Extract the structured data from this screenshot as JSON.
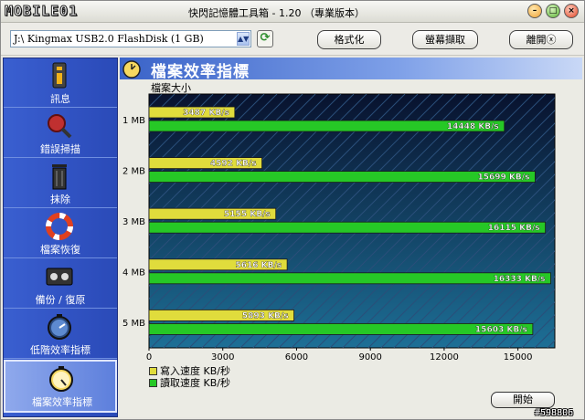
{
  "window": {
    "logo_text": "MOBILE01",
    "title": "快閃記憶體工具箱 - 1.20 （專業版本）"
  },
  "toolbar": {
    "drive": "J:\\ Kingmax USB2.0 FlashDisk (1 GB)",
    "format_label": "格式化",
    "capture_label": "螢幕擷取",
    "leave_label": "離開ⓧ"
  },
  "sidebar": {
    "items": [
      {
        "label": "訊息",
        "icon": "info-icon"
      },
      {
        "label": "錯誤掃描",
        "icon": "magnifier-icon"
      },
      {
        "label": "抹除",
        "icon": "trash-icon"
      },
      {
        "label": "檔案恢復",
        "icon": "lifebuoy-icon"
      },
      {
        "label": "備份 / 復原",
        "icon": "tape-icon"
      },
      {
        "label": "低階效率指標",
        "icon": "stopwatch-icon"
      },
      {
        "label": "檔案效率指標",
        "icon": "stopwatch-icon",
        "active": true
      }
    ]
  },
  "main": {
    "title": "檔案效率指標",
    "caption": "檔案大小",
    "start_label": "開始"
  },
  "chart_data": {
    "type": "bar",
    "orientation": "horizontal",
    "categories": [
      "1 MB",
      "2 MB",
      "3 MB",
      "4 MB",
      "5 MB"
    ],
    "series": [
      {
        "name": "寫入速度 KB/秒",
        "values": [
          3487,
          4592,
          5155,
          5616,
          5893
        ],
        "labels": [
          "3487 KB/s",
          "4592 KB/s",
          "5155 KB/s",
          "5616 KB/s",
          "5893 KB/s"
        ],
        "color": "#e0dc3c"
      },
      {
        "name": "讀取速度 KB/秒",
        "values": [
          14448,
          15699,
          16115,
          16333,
          15603
        ],
        "labels": [
          "14448 KB/s",
          "15699 KB/s",
          "16115 KB/s",
          "16333 KB/s",
          "15603 KB/s"
        ],
        "color": "#26c826"
      }
    ],
    "xticks": [
      "0",
      "3000",
      "6000",
      "9000",
      "12000",
      "15000"
    ],
    "xlim": [
      0,
      16500
    ],
    "grid": true,
    "legend_position": "bottom-left"
  },
  "watermark": "#598806"
}
